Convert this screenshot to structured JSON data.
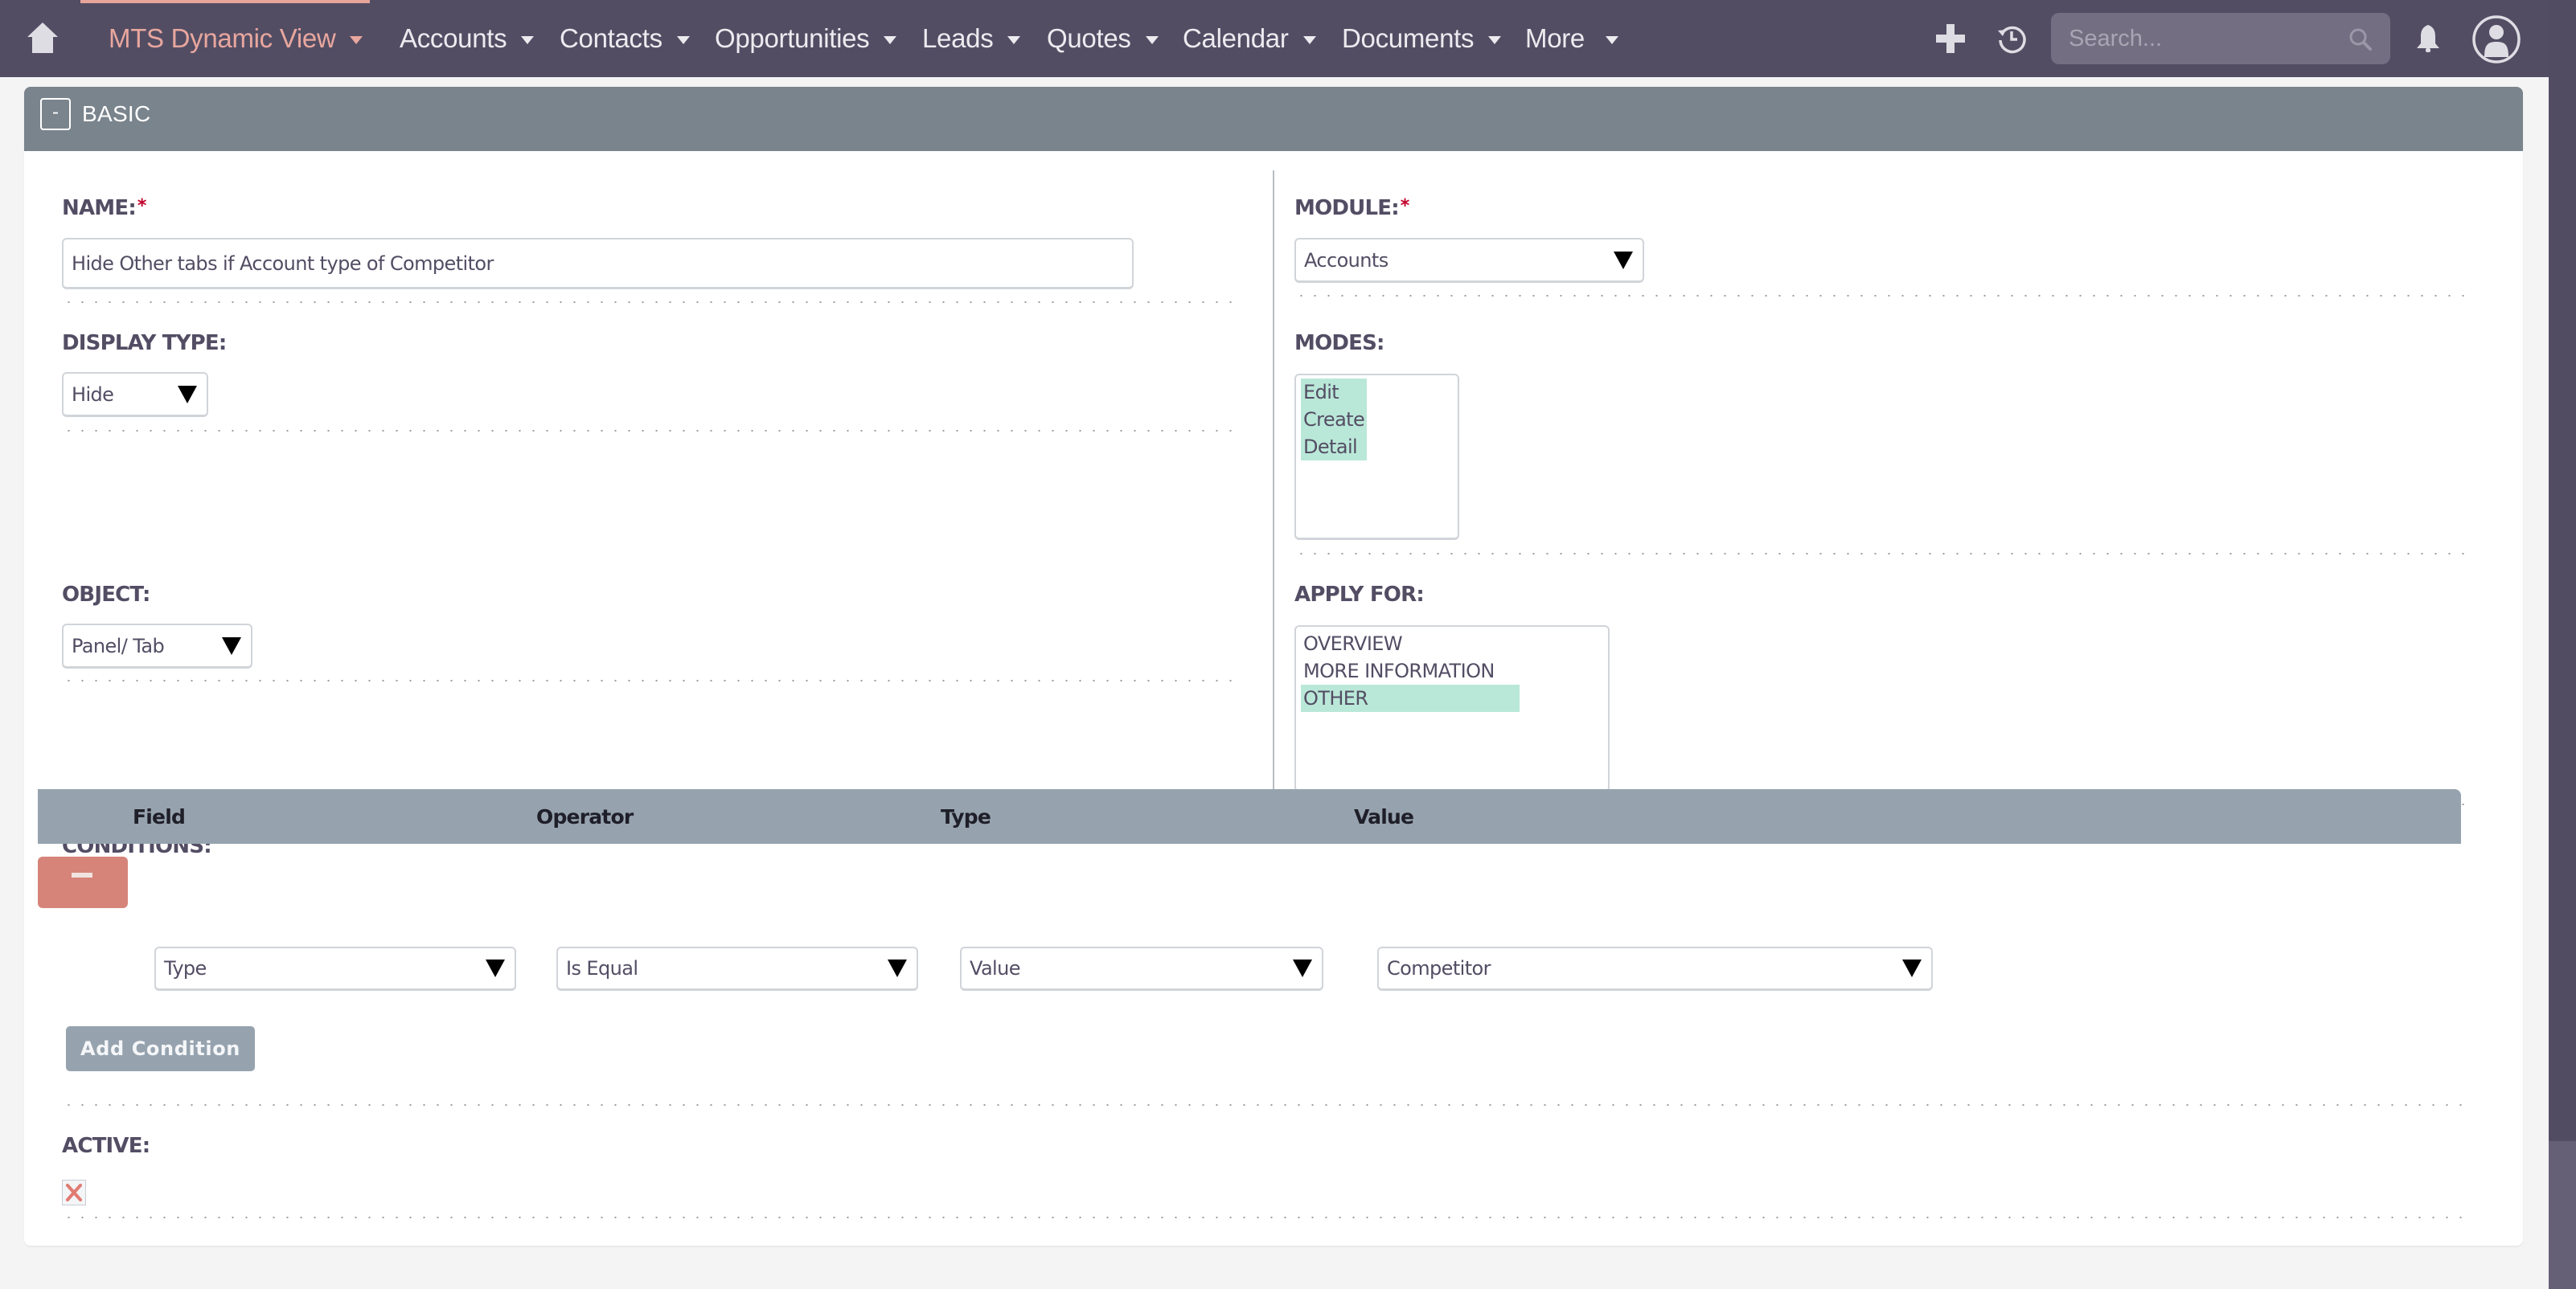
{
  "nav": {
    "brand": "MTS Dynamic View",
    "items": [
      {
        "label": "Accounts"
      },
      {
        "label": "Contacts"
      },
      {
        "label": "Opportunities"
      },
      {
        "label": "Leads"
      },
      {
        "label": "Quotes"
      },
      {
        "label": "Calendar"
      },
      {
        "label": "Documents"
      },
      {
        "label": "More"
      }
    ],
    "search_placeholder": "Search...",
    "icons": [
      "home-icon",
      "plus-icon",
      "history-icon",
      "search-icon",
      "bell-icon",
      "user-avatar-icon"
    ]
  },
  "panel": {
    "title": "BASIC",
    "collapse_symbol": "-"
  },
  "form": {
    "name": {
      "label": "NAME:",
      "required": "*",
      "value": "Hide Other tabs if Account type of Competitor"
    },
    "module": {
      "label": "MODULE:",
      "required": "*",
      "value": "Accounts"
    },
    "display_type": {
      "label": "DISPLAY TYPE:",
      "value": "Hide"
    },
    "modes": {
      "label": "MODES:",
      "options": [
        {
          "label": "Edit",
          "selected": true
        },
        {
          "label": "Create",
          "selected": true
        },
        {
          "label": "Detail",
          "selected": true
        }
      ]
    },
    "object": {
      "label": "OBJECT:",
      "value": "Panel/ Tab"
    },
    "apply_for": {
      "label": "APPLY FOR:",
      "options": [
        {
          "label": "OVERVIEW",
          "selected": false
        },
        {
          "label": "MORE INFORMATION",
          "selected": false
        },
        {
          "label": "OTHER",
          "selected": true
        }
      ]
    },
    "conditions": {
      "label": "CONDITIONS:",
      "columns": [
        "Field",
        "Operator",
        "Type",
        "Value"
      ],
      "rows": [
        {
          "field": "Type",
          "operator": "Is Equal",
          "type": "Value",
          "value": "Competitor"
        }
      ],
      "add_label": "Add Condition"
    },
    "active": {
      "label": "ACTIVE:",
      "checked": false
    }
  },
  "colors": {
    "nav_bg": "#534d64",
    "brand": "#e8a79e",
    "panel_header": "#7a848d",
    "table_header": "#96a3af",
    "remove_button": "#d68479",
    "selected_option": "#bae8d8",
    "required": "#c1002a"
  }
}
